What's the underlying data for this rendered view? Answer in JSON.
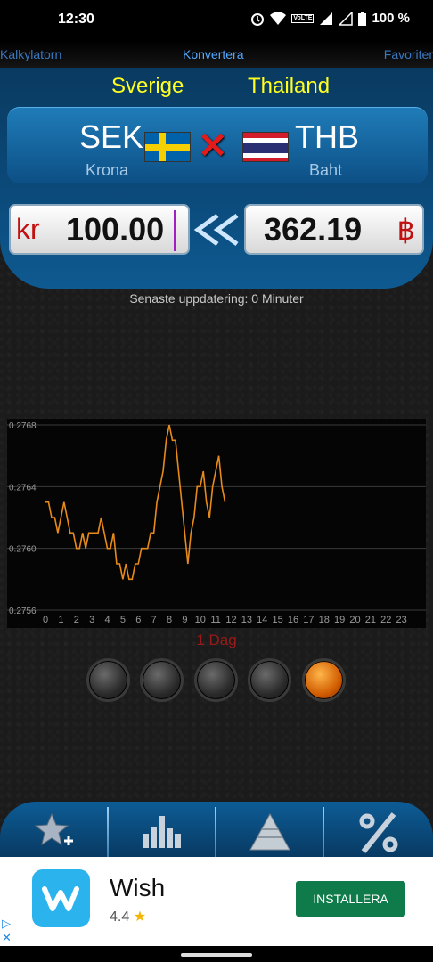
{
  "status": {
    "time": "12:30",
    "battery": "100 %",
    "volte": "VoLTE"
  },
  "tabs": {
    "left": "Kalkylatorn",
    "center": "Konvertera",
    "right": "Favoriter"
  },
  "countries": {
    "from": "Sverige",
    "to": "Thailand"
  },
  "currency": {
    "from_code": "SEK",
    "from_name": "Krona",
    "to_code": "THB",
    "to_name": "Baht"
  },
  "amounts": {
    "from_symbol": "kr",
    "from_value": "100.00",
    "to_symbol": "฿",
    "to_value": "362.19"
  },
  "update_text": "Senaste uppdatering: 0 Minuter",
  "chart_data": {
    "type": "line",
    "title": "",
    "xlabel": "",
    "ylabel": "",
    "x_ticks": [
      "0",
      "1",
      "2",
      "3",
      "4",
      "5",
      "6",
      "7",
      "8",
      "9",
      "10",
      "11",
      "12",
      "13",
      "14",
      "15",
      "16",
      "17",
      "18",
      "19",
      "20",
      "21",
      "22",
      "23"
    ],
    "y_ticks": [
      "0.2768",
      "0.2764",
      "0.2760",
      "0.2756"
    ],
    "ylim": [
      0.2756,
      0.2768
    ],
    "xlim": [
      0,
      24
    ],
    "grid": true,
    "series": [
      {
        "color": "#e88a1a",
        "x": [
          0,
          0.2,
          0.4,
          0.6,
          0.8,
          1.0,
          1.2,
          1.4,
          1.6,
          1.8,
          2.0,
          2.2,
          2.4,
          2.6,
          2.8,
          3.0,
          3.2,
          3.4,
          3.6,
          3.8,
          4.0,
          4.2,
          4.4,
          4.6,
          4.8,
          5.0,
          5.2,
          5.4,
          5.6,
          5.8,
          6.0,
          6.2,
          6.4,
          6.6,
          6.8,
          7.0,
          7.2,
          7.4,
          7.6,
          7.8,
          8.0,
          8.2,
          8.4,
          8.6,
          8.8,
          9.0,
          9.2,
          9.4,
          9.6,
          9.8,
          10.0,
          10.2,
          10.4,
          10.6,
          10.8,
          11.0,
          11.2,
          11.4,
          11.6
        ],
        "y": [
          0.2763,
          0.2763,
          0.2762,
          0.2762,
          0.2761,
          0.2762,
          0.2763,
          0.2762,
          0.2761,
          0.2761,
          0.276,
          0.276,
          0.2761,
          0.276,
          0.2761,
          0.2761,
          0.2761,
          0.2761,
          0.2762,
          0.2761,
          0.276,
          0.276,
          0.2761,
          0.2759,
          0.2759,
          0.2758,
          0.2759,
          0.2758,
          0.2758,
          0.2759,
          0.2759,
          0.276,
          0.276,
          0.276,
          0.2761,
          0.2761,
          0.2763,
          0.2764,
          0.2765,
          0.2767,
          0.2768,
          0.2767,
          0.2767,
          0.2765,
          0.2763,
          0.2761,
          0.2759,
          0.2761,
          0.2762,
          0.2764,
          0.2764,
          0.2765,
          0.2763,
          0.2762,
          0.2764,
          0.2765,
          0.2766,
          0.2764,
          0.2763
        ]
      }
    ]
  },
  "period_label": "1 Dag",
  "period_buttons": 5,
  "active_period": 5,
  "toolbar": [
    "add-favorite-icon",
    "bar-chart-icon",
    "pyramid-icon",
    "percent-icon"
  ],
  "ad": {
    "title": "Wish",
    "rating": "4.4",
    "star": "★",
    "button": "INSTALLERA",
    "choices": "▷\n✕"
  }
}
